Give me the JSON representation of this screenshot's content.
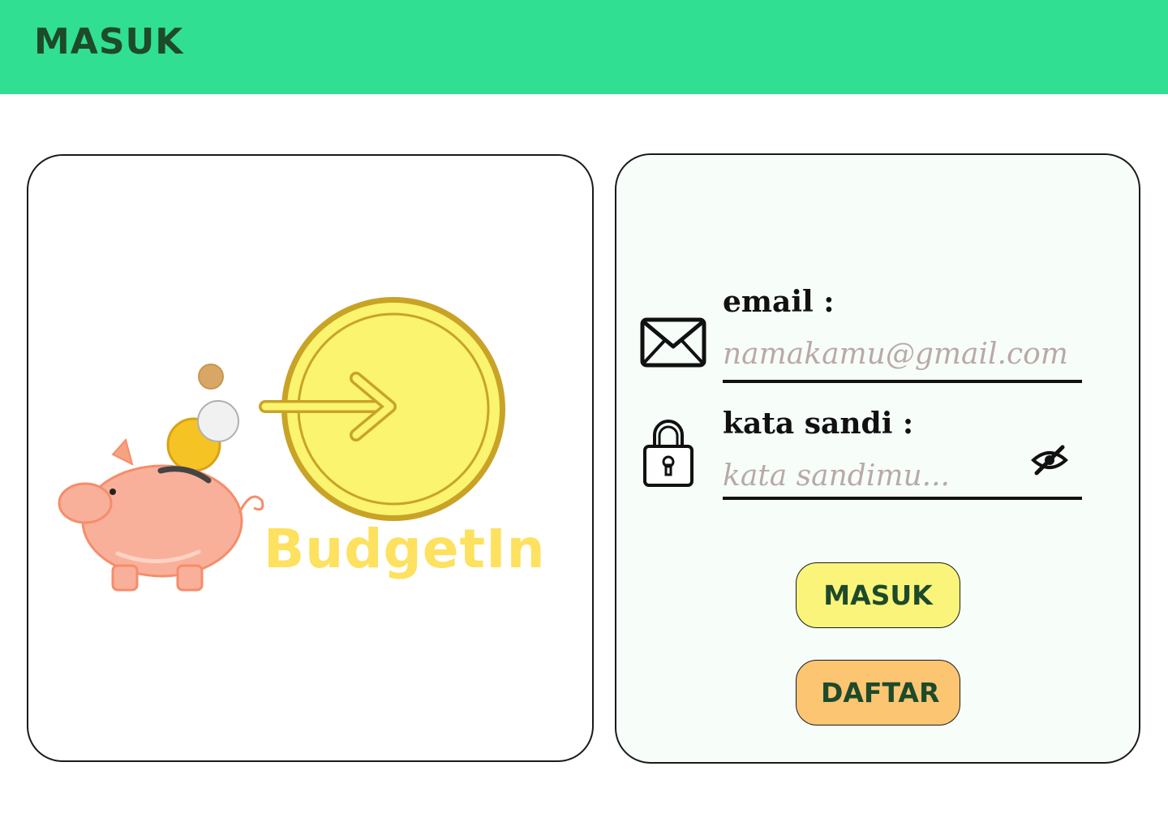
{
  "header": {
    "title": "MASUK"
  },
  "brand": {
    "name": "BudgetIn",
    "color": "#fde15f"
  },
  "form": {
    "email": {
      "label": "email :",
      "placeholder": "namakamu@gmail.com",
      "icon": "mail-icon"
    },
    "password": {
      "label": "kata sandi :",
      "placeholder": "kata sandimu...",
      "icon": "lock-icon",
      "toggle_icon": "eye-off-icon"
    },
    "login_label": "MASUK",
    "register_label": "DAFTAR"
  },
  "colors": {
    "header_bg": "#31df92",
    "header_text": "#1d4a2a",
    "login_button": "#faf57a",
    "register_button": "#fcc572",
    "placeholder": "#b9a9a9"
  }
}
